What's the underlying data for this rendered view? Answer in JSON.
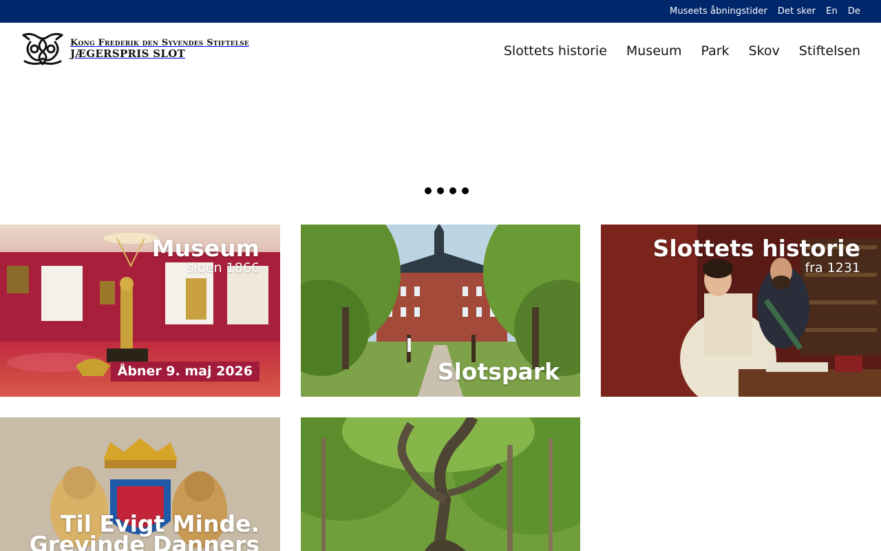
{
  "topbar": {
    "links": [
      "Museets åbningstider",
      "Det sker",
      "En",
      "De"
    ]
  },
  "logo": {
    "line1": "Kong Frederik den Syvendes Stiftelse",
    "line2": "JÆGERSPRIS SLOT"
  },
  "nav": {
    "items": [
      "Slottets historie",
      "Museum",
      "Park",
      "Skov",
      "Stiftelsen"
    ]
  },
  "carousel": {
    "dot_count": 4
  },
  "tiles": {
    "museum": {
      "title": "Museum",
      "subtitle": "siden 1866",
      "badge": "Åbner 9. maj 2026"
    },
    "slotspark": {
      "title": "Slotspark"
    },
    "history": {
      "title": "Slottets historie",
      "subtitle": "fra 1231"
    },
    "danner": {
      "title_line1": "Til Evigt Minde.",
      "title_line2": "Grevinde Danners"
    },
    "forest": {}
  },
  "colors": {
    "topbar": "#00266b",
    "badge": "#a01a3a",
    "text": "#111111"
  },
  "icons": {
    "logo": "royal-monogram-icon",
    "carousel": "carousel-dot-icon"
  }
}
